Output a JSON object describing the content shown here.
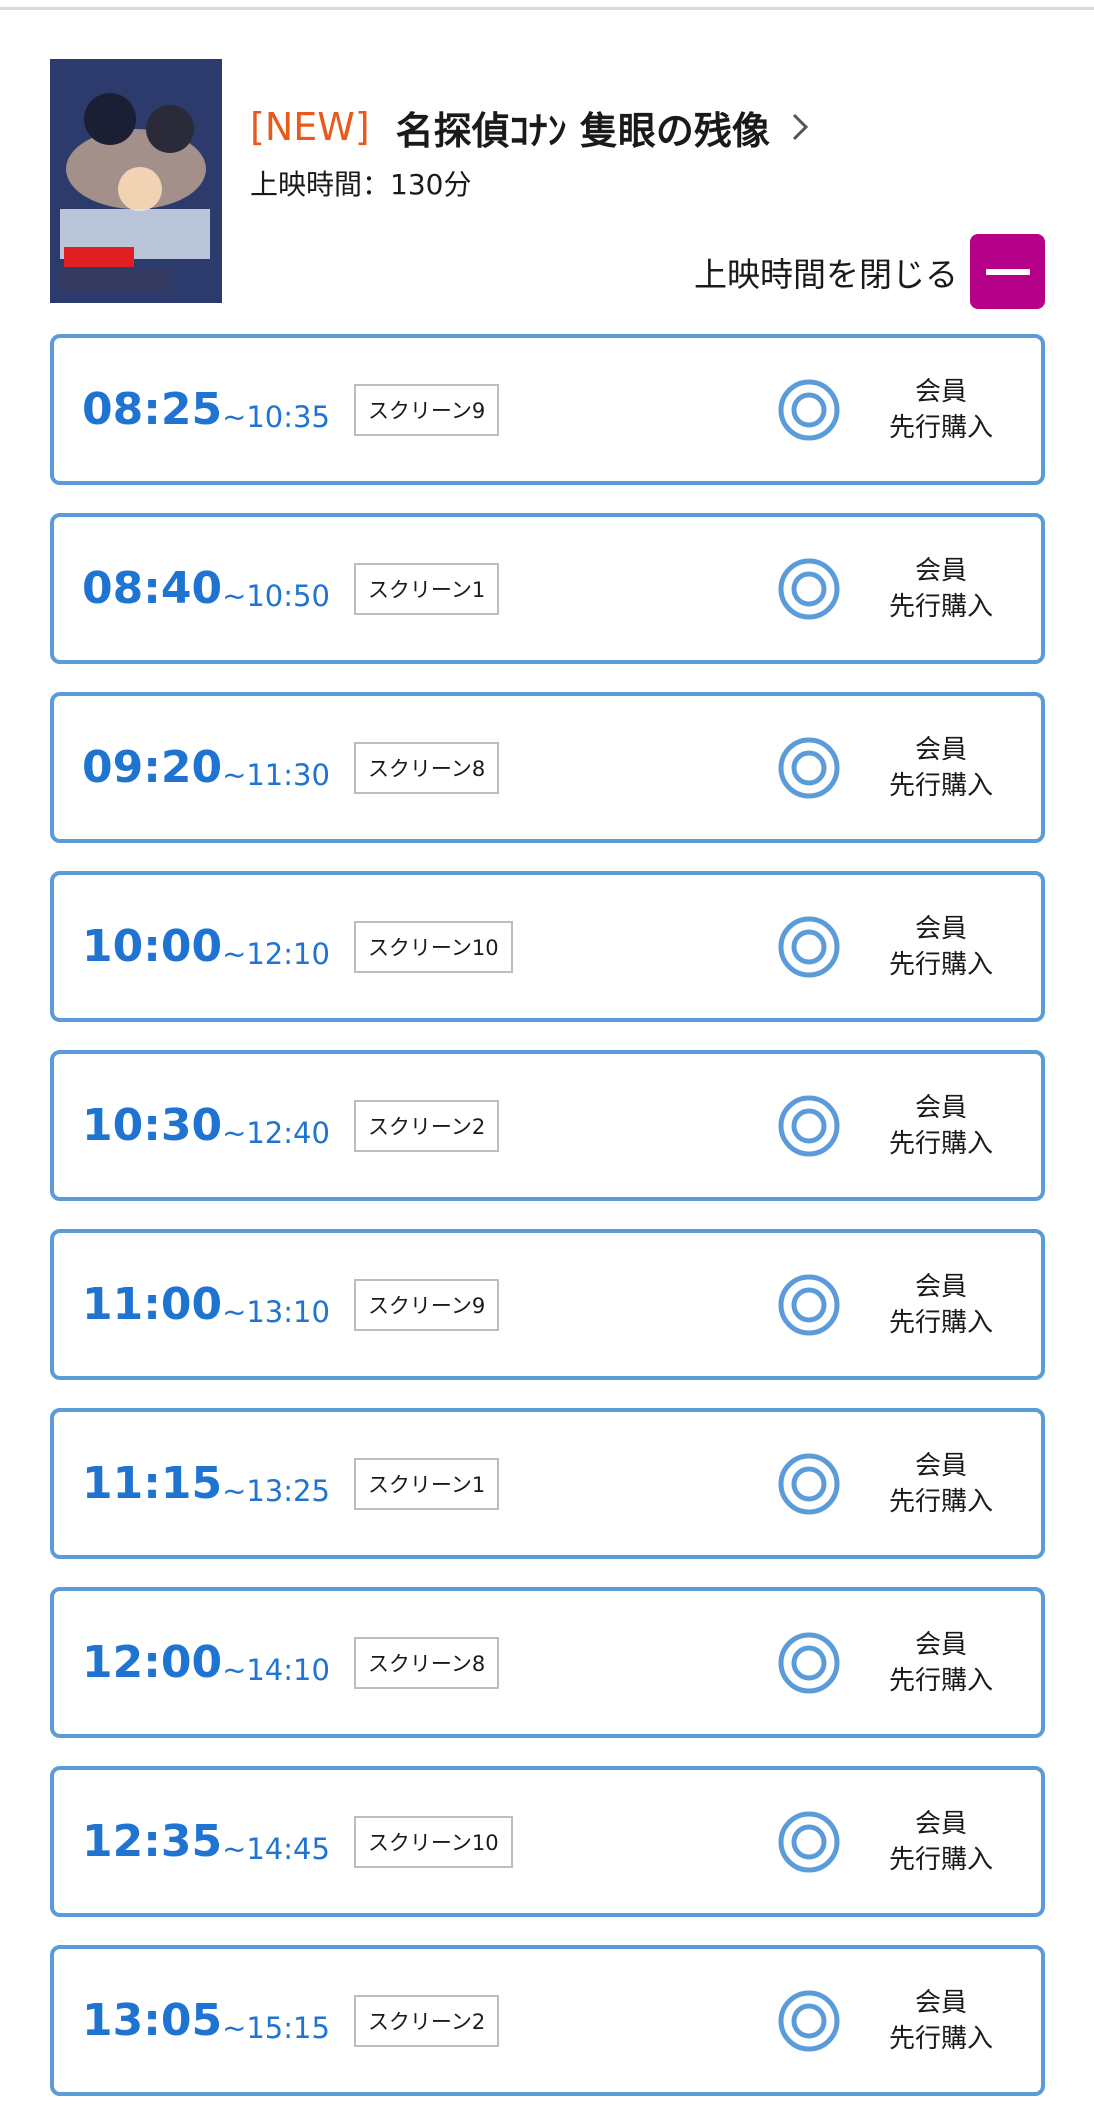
{
  "movie": {
    "new_tag": "[NEW]",
    "title": "名探偵ｺﾅﾝ 隻眼の残像",
    "runtime": "上映時間：130分",
    "poster_alt": "名探偵コナン 隻眼の残像 poster",
    "close_label": "上映時間を閉じる"
  },
  "colors": {
    "accent_blue": "#1f74d1",
    "border_blue": "#5b9bd9",
    "new_tag_orange": "#e85a1b",
    "close_button_magenta": "#b5008a"
  },
  "showtimes": [
    {
      "start": "08:25",
      "end": "~10:35",
      "screen": "スクリーン9",
      "member_line1": "会員",
      "member_line2": "先行購入",
      "status_icon": "double-circle-icon"
    },
    {
      "start": "08:40",
      "end": "~10:50",
      "screen": "スクリーン1",
      "member_line1": "会員",
      "member_line2": "先行購入",
      "status_icon": "double-circle-icon"
    },
    {
      "start": "09:20",
      "end": "~11:30",
      "screen": "スクリーン8",
      "member_line1": "会員",
      "member_line2": "先行購入",
      "status_icon": "double-circle-icon"
    },
    {
      "start": "10:00",
      "end": "~12:10",
      "screen": "スクリーン10",
      "member_line1": "会員",
      "member_line2": "先行購入",
      "status_icon": "double-circle-icon"
    },
    {
      "start": "10:30",
      "end": "~12:40",
      "screen": "スクリーン2",
      "member_line1": "会員",
      "member_line2": "先行購入",
      "status_icon": "double-circle-icon"
    },
    {
      "start": "11:00",
      "end": "~13:10",
      "screen": "スクリーン9",
      "member_line1": "会員",
      "member_line2": "先行購入",
      "status_icon": "double-circle-icon"
    },
    {
      "start": "11:15",
      "end": "~13:25",
      "screen": "スクリーン1",
      "member_line1": "会員",
      "member_line2": "先行購入",
      "status_icon": "double-circle-icon"
    },
    {
      "start": "12:00",
      "end": "~14:10",
      "screen": "スクリーン8",
      "member_line1": "会員",
      "member_line2": "先行購入",
      "status_icon": "double-circle-icon"
    },
    {
      "start": "12:35",
      "end": "~14:45",
      "screen": "スクリーン10",
      "member_line1": "会員",
      "member_line2": "先行購入",
      "status_icon": "double-circle-icon"
    },
    {
      "start": "13:05",
      "end": "~15:15",
      "screen": "スクリーン2",
      "member_line1": "会員",
      "member_line2": "先行購入",
      "status_icon": "double-circle-icon"
    }
  ]
}
